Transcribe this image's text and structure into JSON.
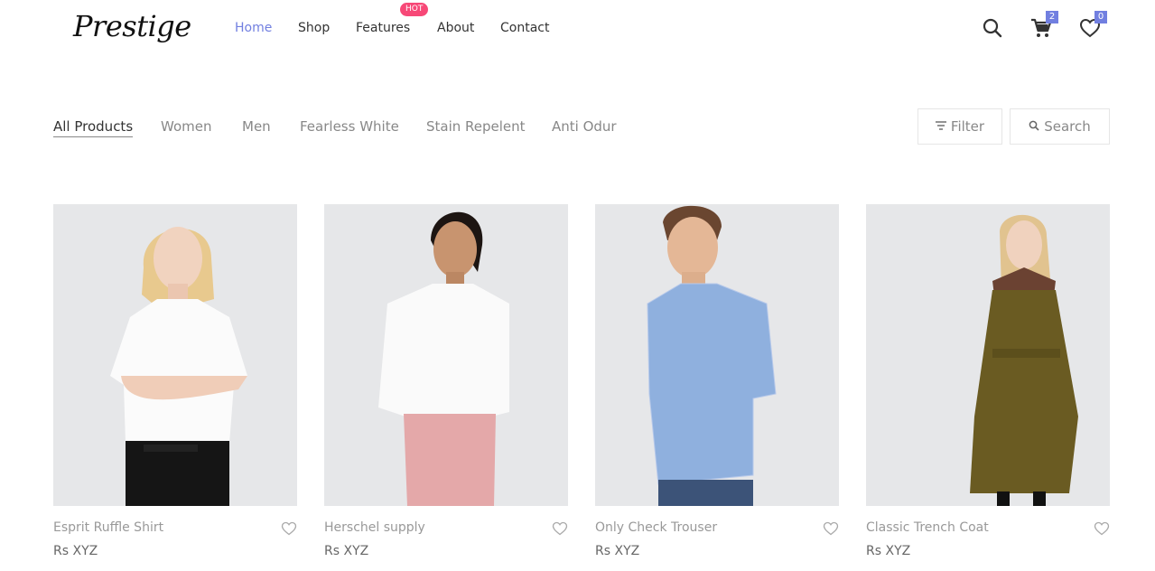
{
  "brand": {
    "logo_text": "Prestige"
  },
  "nav": {
    "items": [
      {
        "label": "Home",
        "active": true
      },
      {
        "label": "Shop",
        "active": false
      },
      {
        "label": "Features",
        "active": false
      },
      {
        "label": "About",
        "active": false
      },
      {
        "label": "Contact",
        "active": false
      }
    ],
    "hot_badge": "HOT"
  },
  "header_icons": {
    "search": "search-icon",
    "cart": {
      "icon": "cart-icon",
      "count": "2"
    },
    "wishlist": {
      "icon": "heart-icon",
      "count": "0"
    }
  },
  "categories": [
    {
      "label": "All Products",
      "active": true
    },
    {
      "label": "Women",
      "active": false
    },
    {
      "label": "Men",
      "active": false
    },
    {
      "label": "Fearless White",
      "active": false
    },
    {
      "label": "Stain Repelent",
      "active": false
    },
    {
      "label": "Anti Odur",
      "active": false
    }
  ],
  "tools": {
    "filter_label": "Filter",
    "search_label": "Search"
  },
  "products": [
    {
      "name": "Esprit Ruffle Shirt",
      "price": "Rs XYZ"
    },
    {
      "name": "Herschel supply",
      "price": "Rs XYZ"
    },
    {
      "name": "Only Check Trouser",
      "price": "Rs XYZ"
    },
    {
      "name": "Classic Trench Coat",
      "price": "Rs XYZ"
    }
  ],
  "colors": {
    "accent": "#717fe0",
    "hot": "#f74877",
    "text": "#333333",
    "muted": "#888888",
    "image_bg": "#e5e6e8"
  }
}
